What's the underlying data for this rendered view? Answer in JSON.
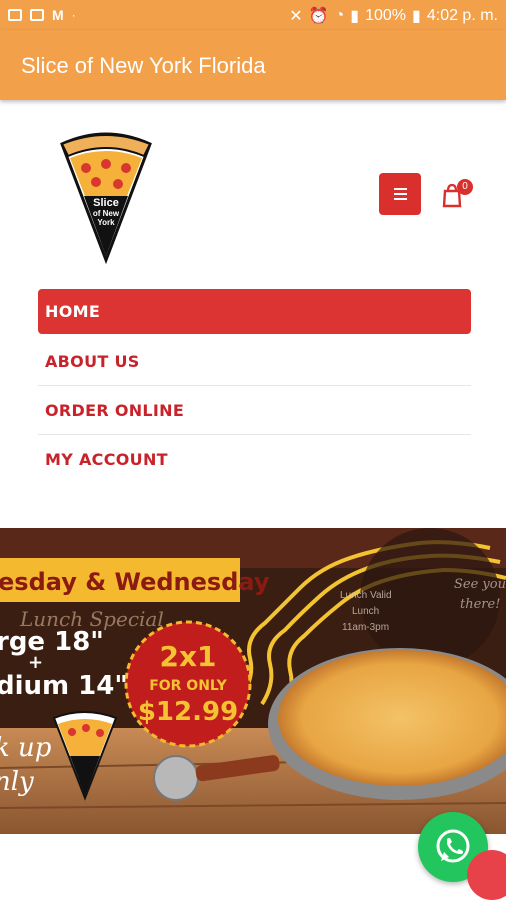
{
  "status_bar": {
    "battery": "100%",
    "time": "4:02 p. m."
  },
  "app_bar": {
    "title": "Slice of New York Florida"
  },
  "logo": {
    "text_lines": [
      "Slice",
      "of New",
      "York"
    ],
    "icon": "pizza-slice-logo"
  },
  "header": {
    "menu_icon": "hamburger-icon",
    "cart_icon": "shopping-bag-icon",
    "cart_count": "0"
  },
  "nav": {
    "items": [
      {
        "label": "HOME",
        "active": true
      },
      {
        "label": "ABOUT US",
        "active": false
      },
      {
        "label": "ORDER ONLINE",
        "active": false
      },
      {
        "label": "MY ACCOUNT",
        "active": false
      }
    ]
  },
  "banner": {
    "days": "esday & Wednesday",
    "script_special": "Lunch Special",
    "sizes_line1": "rge 18\"",
    "plus": "+",
    "sizes_line2": "dium 14\"",
    "deal": "2x1",
    "for_only": "FOR ONLY",
    "price": "$12.99",
    "pickup_line1": "k up",
    "pickup_line2": "nly",
    "hours_title": "Lunch Valid",
    "hours_sub": "Lunch",
    "hours_time": "11am-3pm",
    "see_you": "See you",
    "there": "there!"
  },
  "fab": {
    "whatsapp_icon": "whatsapp-icon"
  },
  "colors": {
    "accent": "#f2a04a",
    "brand_red": "#d9302e"
  }
}
